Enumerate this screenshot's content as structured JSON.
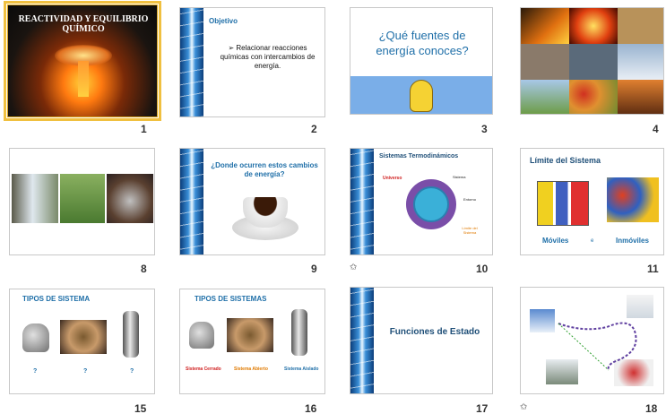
{
  "slides": [
    {
      "number": "1",
      "title_line1": "REACTIVIDAD Y EQUILIBRIO",
      "title_line2": "QUÍMICO"
    },
    {
      "number": "2",
      "heading": "Objetivo",
      "bullet": "Relacionar reacciones químicas con intercambios de energía."
    },
    {
      "number": "3",
      "question": "¿Qué fuentes de energía conoces?"
    },
    {
      "number": "4"
    },
    {
      "number": "8"
    },
    {
      "number": "9",
      "question": "¿Donde ocurren estos cambios de energía?"
    },
    {
      "number": "10",
      "title": "Sistemas Termodinámicos",
      "label_universo": "Universo",
      "label_sistema": "Sistema",
      "label_entorno": "Entorno",
      "label_limite": "Límite del Sistema"
    },
    {
      "number": "11",
      "title": "Límite del Sistema",
      "label_moviles": "Móviles",
      "label_e": "e",
      "label_inmoviles": "Inmóviles"
    },
    {
      "number": "15",
      "title": "TIPOS DE SISTEMA",
      "q1": "?",
      "q2": "?",
      "q3": "?"
    },
    {
      "number": "16",
      "title": "TIPOS DE SISTEMAS",
      "label1": "Sistema Cerrado",
      "label2": "Sistema Abierto",
      "label3": "Sistema Aislado"
    },
    {
      "number": "17",
      "title": "Funciones de Estado"
    },
    {
      "number": "18"
    }
  ],
  "colors": {
    "selection": "#f0c040",
    "accent_blue": "#1f6fa8",
    "red": "#d02020",
    "orange": "#e07a00"
  }
}
